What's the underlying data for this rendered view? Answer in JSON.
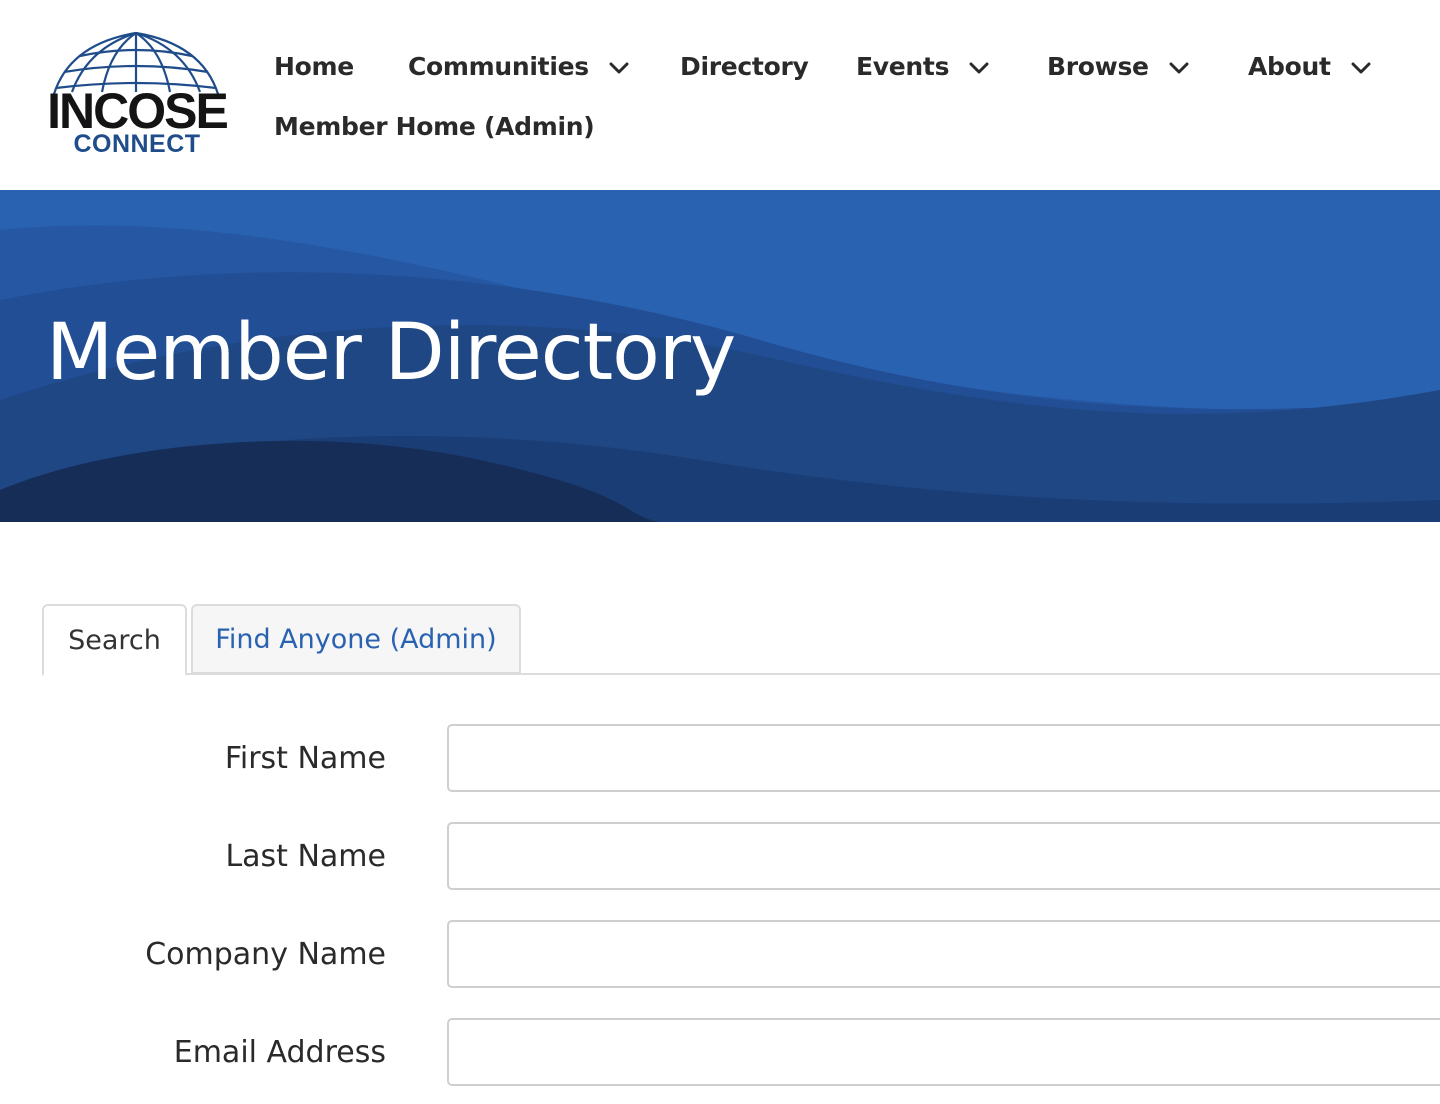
{
  "logo": {
    "title": "INCOSE",
    "subtitle": "CONNECT",
    "icon": "globe-icon",
    "colors": {
      "title": "#141414",
      "subtitle": "#1f4c8a",
      "globe": "#1f4c8a"
    }
  },
  "nav": {
    "items": [
      {
        "label": "Home",
        "has_dropdown": false
      },
      {
        "label": "Communities",
        "has_dropdown": true
      },
      {
        "label": "Directory",
        "has_dropdown": false
      },
      {
        "label": "Events",
        "has_dropdown": true
      },
      {
        "label": "Browse",
        "has_dropdown": true
      },
      {
        "label": "About",
        "has_dropdown": true
      },
      {
        "label": "Member Home (Admin)",
        "has_dropdown": false
      }
    ],
    "dropdown_icon": "chevron-down-icon"
  },
  "banner": {
    "title": "Member Directory",
    "colors": {
      "light": "#2a62b2",
      "mid": "#1f4c8a",
      "dark": "#152d57"
    }
  },
  "tabs": [
    {
      "label": "Search",
      "active": true
    },
    {
      "label": "Find Anyone (Admin)",
      "active": false
    }
  ],
  "form": {
    "fields": [
      {
        "label": "First Name",
        "value": "",
        "placeholder": ""
      },
      {
        "label": "Last Name",
        "value": "",
        "placeholder": ""
      },
      {
        "label": "Company Name",
        "value": "",
        "placeholder": ""
      },
      {
        "label": "Email Address",
        "value": "",
        "placeholder": ""
      }
    ]
  },
  "colors": {
    "link": "#2a62b2",
    "text": "#2a2a2a",
    "border": "#cfcfcf"
  }
}
